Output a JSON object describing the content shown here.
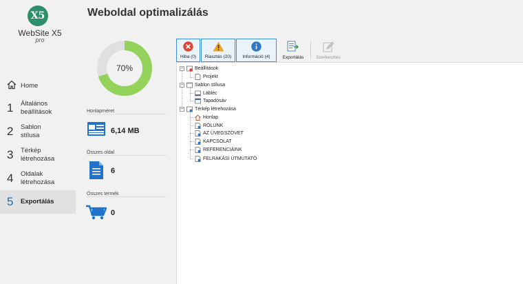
{
  "header": {
    "title": "Weboldal optimalizálás"
  },
  "logo": {
    "badge": "X5",
    "name": "WebSite X5",
    "edition": "pro"
  },
  "sidebar": {
    "home": {
      "label": "Home"
    },
    "items": [
      {
        "num": "1",
        "label_l1": "Általános",
        "label_l2": "beállítások"
      },
      {
        "num": "2",
        "label_l1": "Sablon",
        "label_l2": "stílusa"
      },
      {
        "num": "3",
        "label_l1": "Térkép",
        "label_l2": "létrehozása"
      },
      {
        "num": "4",
        "label_l1": "Oldalak",
        "label_l2": "létrehozása"
      },
      {
        "num": "5",
        "label_l1": "Exportálás",
        "label_l2": ""
      }
    ],
    "active_index": 4
  },
  "stats": {
    "progress": {
      "value_text": "70%",
      "fraction": 0.7
    },
    "size": {
      "label": "Honlapméret",
      "value": "6,14 MB"
    },
    "pages": {
      "label": "Összes oldal",
      "value": "6"
    },
    "products": {
      "label": "Összes termék",
      "value": "0"
    }
  },
  "toolbar": {
    "error": "Hiba (0)",
    "warning": "Riasztás (20)",
    "info": "Információ (4)",
    "export": "Exportálás",
    "edit": "Szerkesztés"
  },
  "tree": {
    "settings": "Beállítások",
    "project": "Projekt",
    "template": "Sablon stílusa",
    "footer": "Lábléc",
    "header": "Tapadósáv",
    "map": "Térkép létrehozása",
    "pages": [
      "Honlap",
      "RÓLUNK",
      "AZ ÜVEGSZÖVET",
      "KAPCSOLAT",
      "REFERENCIÁINK",
      "FELRAKÁSI ÚTMUTATÓ"
    ]
  },
  "colors": {
    "accent": "#1a6fb5",
    "donut_fill": "#93d35c",
    "donut_track": "#e0e0e0",
    "error": "#e04434",
    "warning": "#e8a32b",
    "info": "#2f78c4"
  }
}
